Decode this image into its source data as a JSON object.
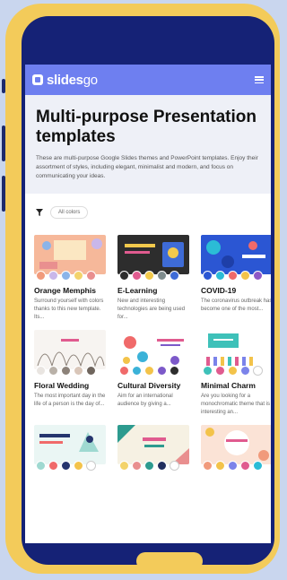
{
  "app": {
    "brand": "slides",
    "brand_suffix": "go"
  },
  "hero": {
    "title": "Multi-purpose Presentation templates",
    "description": "These are multi-purpose Google Slides themes and PowerPoint templates. Enjoy their assortment of styles, including elegant, minimalist and modern, and focus on communicating your ideas."
  },
  "filter": {
    "chip": "All colors"
  },
  "cards": [
    {
      "name": "Orange Memphis",
      "desc": "Surround yourself with colors thanks to this new template. Its...",
      "colors": [
        "#f19a7b",
        "#c9b7ea",
        "#8bb4e9",
        "#f3d36a",
        "#e98f8f"
      ]
    },
    {
      "name": "E-Learning",
      "desc": "New and interesting technologies are being used for...",
      "colors": [
        "#2d2d2d",
        "#e05b8f",
        "#f2c94c",
        "#7f8c8d",
        "#3e6bd6"
      ]
    },
    {
      "name": "COVID-19",
      "desc": "The coronavirus outbreak has become one of the most...",
      "colors": [
        "#2b56d3",
        "#2bbcd6",
        "#f06a6a",
        "#f3c34a",
        "#8e58c6"
      ]
    },
    {
      "name": "Floral Wedding",
      "desc": "The most important day in the life of a person is the day of...",
      "colors": [
        "#e9e5e1",
        "#b9b1a8",
        "#8c8279",
        "#d9c6b9",
        "#6f655d"
      ]
    },
    {
      "name": "Cultural Diversity",
      "desc": "Aim for an international audience by giving a...",
      "colors": [
        "#f06a6a",
        "#3bb2d8",
        "#f3c34a",
        "#7c59c9",
        "#2d2d2d"
      ]
    },
    {
      "name": "Minimal Charm",
      "desc": "Are you looking for a monochromatic theme that is interesting an...",
      "colors": [
        "#3ec1b9",
        "#e05b8f",
        "#f3c34a",
        "#7b83ea",
        "#ffffff"
      ]
    },
    {
      "name": "",
      "desc": "",
      "colors": [
        "#9fd9d1",
        "#f06a6a",
        "#25356e",
        "#f3c34a",
        "#ffffff"
      ]
    },
    {
      "name": "",
      "desc": "",
      "colors": [
        "#f3d36a",
        "#e98f8f",
        "#2d9b8f",
        "#222f5e",
        "#ffffff"
      ]
    },
    {
      "name": "",
      "desc": "",
      "colors": [
        "#f19a7b",
        "#f3c34a",
        "#7b83ea",
        "#e05b8f",
        "#2bbcd6"
      ]
    }
  ],
  "colors": {
    "frame": "#f3cb5a",
    "screen": "#152276",
    "appbar": "#6e7ff0",
    "hero_bg": "#eef0f7"
  },
  "icons": [
    "logo-icon",
    "menu-icon",
    "filter-icon"
  ]
}
